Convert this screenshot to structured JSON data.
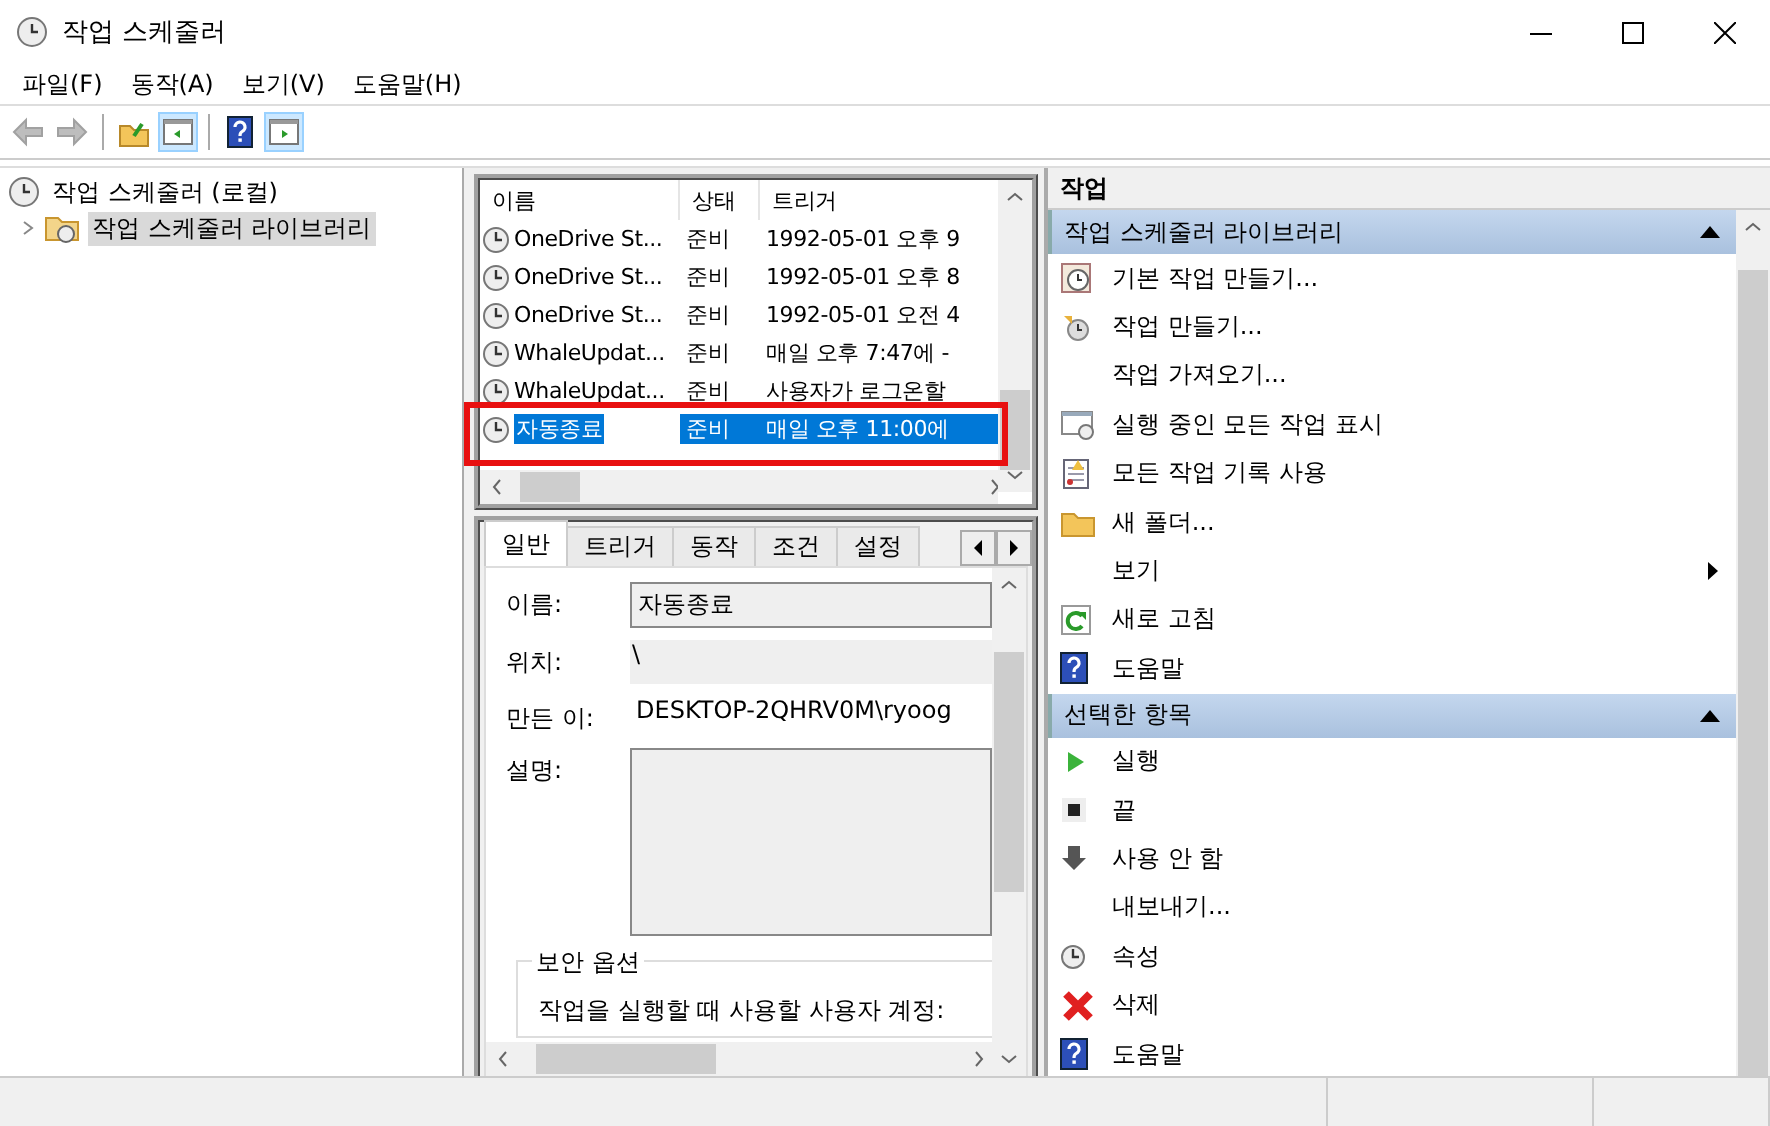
{
  "window": {
    "title": "작업 스케줄러"
  },
  "menu": [
    {
      "label": "파일(F)"
    },
    {
      "label": "동작(A)"
    },
    {
      "label": "보기(V)"
    },
    {
      "label": "도움말(H)"
    }
  ],
  "toolbar": [
    {
      "kind": "back",
      "disabled": true,
      "pressed": false
    },
    {
      "kind": "forward",
      "disabled": true,
      "pressed": false
    },
    {
      "kind": "separator"
    },
    {
      "kind": "up",
      "disabled": false,
      "pressed": false
    },
    {
      "kind": "console-tree",
      "disabled": false,
      "pressed": true
    },
    {
      "kind": "separator"
    },
    {
      "kind": "help",
      "disabled": false,
      "pressed": false
    },
    {
      "kind": "action-pane",
      "disabled": false,
      "pressed": true
    }
  ],
  "tree": [
    {
      "label": "작업 스케줄러 (로컬)",
      "selected": false,
      "children": [
        {
          "label": "작업 스케줄러 라이브러리",
          "selected": true,
          "expanded": false
        }
      ]
    }
  ],
  "task_list": {
    "columns": [
      "이름",
      "상태",
      "트리거"
    ],
    "rows": [
      {
        "cells": [
          "OneDrive St...",
          "준비",
          "1992-05-01 오후 9"
        ],
        "selected": false,
        "marked": false
      },
      {
        "cells": [
          "OneDrive St...",
          "준비",
          "1992-05-01 오후 8"
        ],
        "selected": false,
        "marked": false
      },
      {
        "cells": [
          "OneDrive St...",
          "준비",
          "1992-05-01 오전 4"
        ],
        "selected": false,
        "marked": false
      },
      {
        "cells": [
          "WhaleUpdat...",
          "준비",
          "매일 오후 7:47에 -"
        ],
        "selected": false,
        "marked": false
      },
      {
        "cells": [
          "WhaleUpdat...",
          "준비",
          "사용자가 로그온할"
        ],
        "selected": false,
        "marked": false
      },
      {
        "cells": [
          "자동종료",
          "준비",
          "매일 오후 11:00에"
        ],
        "selected": true,
        "marked": true
      }
    ]
  },
  "details": {
    "tabs": [
      {
        "label": "일반",
        "selected": true
      },
      {
        "label": "트리거",
        "selected": false
      },
      {
        "label": "동작",
        "selected": false
      },
      {
        "label": "조건",
        "selected": false
      },
      {
        "label": "설정",
        "selected": false
      }
    ],
    "fields": [
      {
        "label": "이름:",
        "value": "자동종료",
        "kind": "box"
      },
      {
        "label": "위치:",
        "value": "\\",
        "kind": "shaded"
      },
      {
        "label": "만든 이:",
        "value": "DESKTOP-2QHRV0M\\ryoog",
        "kind": "plain"
      },
      {
        "label": "설명:",
        "kind": "area"
      }
    ],
    "security": {
      "title": "보안 옵션",
      "text": "작업을 실행할 때 사용할 사용자 계정:"
    }
  },
  "actions": {
    "title": "작업",
    "sections": [
      {
        "title": "작업 스케줄러 라이브러리",
        "expanded": true,
        "items": [
          {
            "label": "기본 작업 만들기...",
            "kind": "wizard"
          },
          {
            "label": "작업 만들기...",
            "kind": "new-task"
          },
          {
            "label": "작업 가져오기...",
            "kind": "plain"
          },
          {
            "label": "실행 중인 모든 작업 표시",
            "kind": "running"
          },
          {
            "label": "모든 작업 기록 사용",
            "kind": "history"
          },
          {
            "label": "새 폴더...",
            "kind": "folder"
          },
          {
            "label": "보기",
            "kind": "plain",
            "submenu": true
          },
          {
            "label": "새로 고침",
            "kind": "refresh"
          },
          {
            "label": "도움말",
            "kind": "help"
          }
        ]
      },
      {
        "title": "선택한 항목",
        "expanded": true,
        "items": [
          {
            "label": "실행",
            "kind": "run"
          },
          {
            "label": "끝",
            "kind": "end"
          },
          {
            "label": "사용 안 함",
            "kind": "disable"
          },
          {
            "label": "내보내기...",
            "kind": "plain"
          },
          {
            "label": "속성",
            "kind": "clock"
          },
          {
            "label": "삭제",
            "kind": "delete"
          },
          {
            "label": "도움말",
            "kind": "help"
          }
        ]
      }
    ]
  }
}
